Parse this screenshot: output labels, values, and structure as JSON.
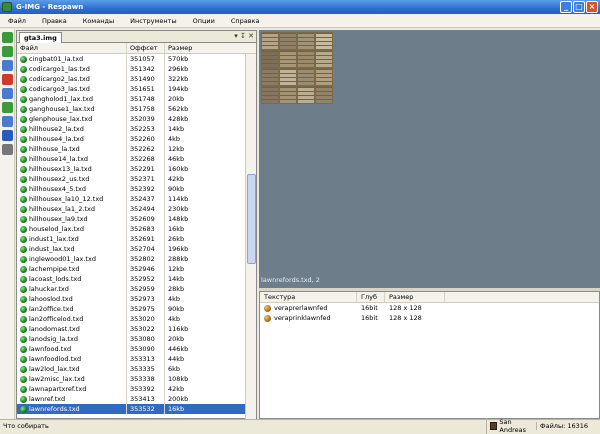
{
  "window": {
    "title": "G-IMG - Respawn",
    "minimize": "_",
    "maximize": "□",
    "close": "×"
  },
  "menu": [
    "Файл",
    "Правка",
    "Команды",
    "Инструменты",
    "Опции",
    "Справка"
  ],
  "toolbar": {
    "icons": [
      "add-icon",
      "replace-icon",
      "info-icon",
      "delete-icon",
      "export-icon",
      "import-icon",
      "rebuild-icon",
      "flag-icon",
      "link-icon"
    ],
    "colors": [
      "#3c9a3c",
      "#3c9a3c",
      "#4a7ad0",
      "#d03a2a",
      "#4a7ad0",
      "#3c9a3c",
      "#4a7ad0",
      "#2a5ac0",
      "#777777"
    ]
  },
  "archive_tab": {
    "label": "gta3.img",
    "controls": "▾ ↧ ✕"
  },
  "file_list": {
    "headers": [
      "Файл",
      "Оффсет",
      "Размер"
    ],
    "rows": [
      [
        "cingbat01_la.txd",
        "351057",
        "570kb"
      ],
      [
        "codicargo1_las.txd",
        "351342",
        "296kb"
      ],
      [
        "codicargo2_las.txd",
        "351490",
        "322kb"
      ],
      [
        "codicargo3_las.txd",
        "351651",
        "194kb"
      ],
      [
        "gangholod1_lax.txd",
        "351748",
        "20kb"
      ],
      [
        "ganghouse1_lax.txd",
        "351758",
        "562kb"
      ],
      [
        "glenphouse_lax.txd",
        "352039",
        "428kb"
      ],
      [
        "hillhouse2_la.txd",
        "352253",
        "14kb"
      ],
      [
        "hillhouse4_la.txd",
        "352260",
        "4kb"
      ],
      [
        "hillhouse_la.txd",
        "352262",
        "12kb"
      ],
      [
        "hillhouse14_la.txd",
        "352268",
        "46kb"
      ],
      [
        "hillhousex13_la.txd",
        "352291",
        "160kb"
      ],
      [
        "hillhousex2_us.txd",
        "352371",
        "42kb"
      ],
      [
        "hillhousex4_5.txd",
        "352392",
        "90kb"
      ],
      [
        "hillhousex_la10_12.txd",
        "352437",
        "114kb"
      ],
      [
        "hillhousex_la1_2.txd",
        "352494",
        "230kb"
      ],
      [
        "hillhousex_la9.txd",
        "352609",
        "148kb"
      ],
      [
        "houselod_lax.txd",
        "352683",
        "16kb"
      ],
      [
        "indust1_lax.txd",
        "352691",
        "26kb"
      ],
      [
        "indust_lax.txd",
        "352704",
        "196kb"
      ],
      [
        "inglewood01_lax.txd",
        "352802",
        "288kb"
      ],
      [
        "lachempipe.txd",
        "352946",
        "12kb"
      ],
      [
        "lacoast_lods.txd",
        "352952",
        "14kb"
      ],
      [
        "lahuckar.txd",
        "352959",
        "28kb"
      ],
      [
        "lahooslod.txd",
        "352973",
        "4kb"
      ],
      [
        "lan2office.txd",
        "352975",
        "90kb"
      ],
      [
        "lan2officelod.txd",
        "353020",
        "4kb"
      ],
      [
        "lanodomast.txd",
        "353022",
        "116kb"
      ],
      [
        "lanodsig_la.txd",
        "353080",
        "20kb"
      ],
      [
        "lawnfood.txd",
        "353090",
        "446kb"
      ],
      [
        "lawnfoodlod.txd",
        "353313",
        "44kb"
      ],
      [
        "law2lod_lax.txd",
        "353335",
        "6kb"
      ],
      [
        "law2misc_lax.txd",
        "353338",
        "108kb"
      ],
      [
        "lawnapartxref.txd",
        "353392",
        "42kb"
      ],
      [
        "lawnref.txd",
        "353413",
        "200kb"
      ],
      [
        "lawnrefords.txd",
        "353532",
        "16kb"
      ]
    ],
    "selected_index": 35
  },
  "preview": {
    "label": "lawnrefords.txd, 2",
    "background": "#6d7d8a",
    "tile_colors": [
      "#b5a487",
      "#8f8066",
      "#a09478",
      "#c8bca0",
      "#7d6e58",
      "#a89878",
      "#9c8a6a",
      "#b8aa8c",
      "#8a7c62",
      "#c2b498",
      "#9a8c70",
      "#b0a080",
      "#867660",
      "#a49476",
      "#bcae90",
      "#928468"
    ]
  },
  "texture_list": {
    "headers": [
      "Текстура",
      "Глуб",
      "Размер"
    ],
    "rows": [
      [
        "veraprerlawnfed",
        "16bit",
        "128 x 128"
      ],
      [
        "veraprinklawnfed",
        "16bit",
        "128 x 128"
      ]
    ]
  },
  "status": {
    "left": "Что собирать",
    "game": "San Andreas",
    "files": "Файлы: 16316"
  }
}
